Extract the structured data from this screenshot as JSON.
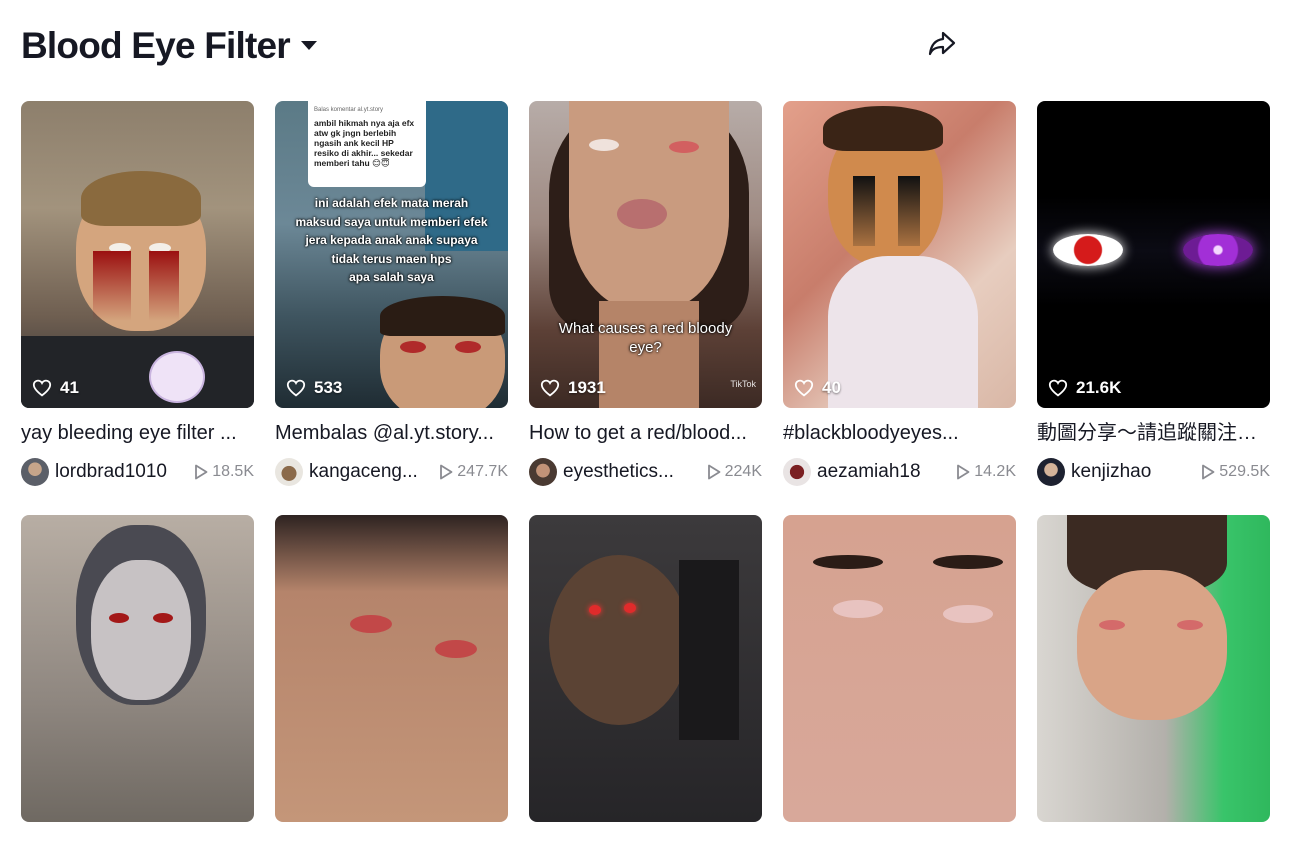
{
  "header": {
    "title": "Blood Eye Filter"
  },
  "icons": {
    "dropdown": "caret-down-icon",
    "share": "share-arrow-icon",
    "like": "heart-icon",
    "views": "play-icon"
  },
  "videos": [
    {
      "likes": "41",
      "caption": "yay bleeding eye filter ...",
      "user": "lordbrad1010",
      "views": "18.5K"
    },
    {
      "likes": "533",
      "caption": "Membalas @al.yt.story...",
      "user": "kangaceng...",
      "views": "247.7K",
      "reply_label": "Balas komentar al.yt.story",
      "reply_text": "ambil hikmah nya aja efx atw gk jngn berlebih ngasih ank kecil HP resiko di akhir... sekedar memberi tahu 😊😇",
      "overlay": [
        "ini adalah efek mata merah",
        "maksud saya untuk memberi efek",
        "jera kepada anak anak supaya",
        "tidak terus maen hps",
        "apa salah saya"
      ]
    },
    {
      "likes": "1931",
      "caption": "How to get a red/blood...",
      "user": "eyesthetics...",
      "views": "224K",
      "overlay": [
        "What causes a red bloody",
        "eye?"
      ],
      "watermark": "TikTok"
    },
    {
      "likes": "40",
      "caption": "#blackbloodyeyes...",
      "user": "aezamiah18",
      "views": "14.2K"
    },
    {
      "likes": "21.6K",
      "caption": "動圖分享～請追蹤關注呀...",
      "user": "kenjizhao",
      "views": "529.5K"
    },
    {
      "likes": "",
      "caption": "",
      "user": "",
      "views": ""
    },
    {
      "likes": "",
      "caption": "",
      "user": "",
      "views": ""
    },
    {
      "likes": "",
      "caption": "",
      "user": "",
      "views": ""
    },
    {
      "likes": "",
      "caption": "",
      "user": "",
      "views": ""
    },
    {
      "likes": "",
      "caption": "",
      "user": "",
      "views": ""
    }
  ]
}
